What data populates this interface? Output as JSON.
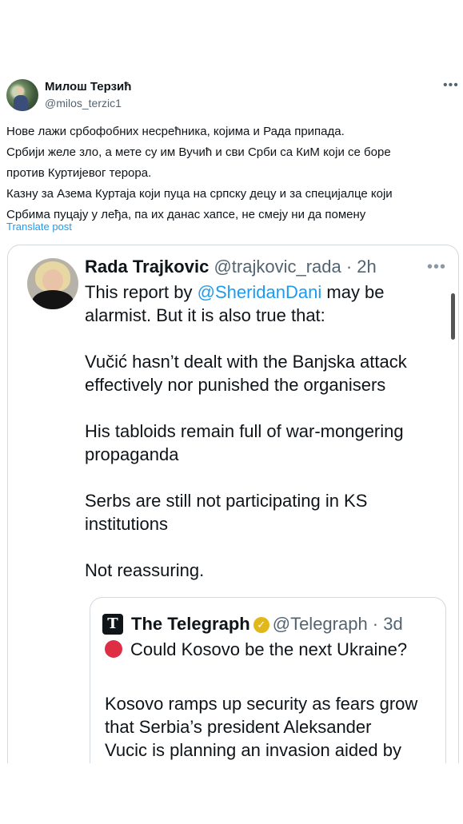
{
  "author": {
    "name": "Милош Терзић",
    "handle": "@milos_terzic1"
  },
  "more_icon": "more-horizontal-icon",
  "post_lines": [
    "Нове лажи србофобних несрећника, којима и Рада припада.",
    "Србији желе зло, а мете су им Вучић и сви Срби са КиМ који се боре",
    "против Куртијевог терора.",
    "Казну за Азема Куртаја који пуца на српску децу и за специјалце који",
    "Србима пуцају у леђа, па их данас хапсе, не смеју ни да помену"
  ],
  "translate_label": "Translate post",
  "embedded": {
    "name": "Rada Trajkovic",
    "handle_time": "@trajkovic_rada · 2h",
    "line1_pre": "This report by ",
    "mention": "@SheridanDani",
    "line1_post": " may be",
    "line2": "alarmist. But it is also true that:",
    "para2": [
      "Vučić hasn’t dealt with the Banjska attack",
      "effectively nor punished the organisers"
    ],
    "para3": [
      "His tabloids remain full of war-mongering",
      "propaganda"
    ],
    "para4": [
      "Serbs are still not participating in KS",
      "institutions"
    ],
    "para5": "Not reassuring."
  },
  "quote": {
    "logo_letter": "T",
    "name": "The Telegraph",
    "handle_time": "@Telegraph · 3d",
    "title": "Could Kosovo be the next Ukraine?",
    "body": [
      "Kosovo ramps up security as fears grow",
      "that Serbia’s president Aleksander",
      "Vucic is planning an invasion aided by"
    ]
  },
  "colors": {
    "link": "#1d9bf0",
    "secondary_text": "#536471",
    "verified_gold": "#e2b719",
    "red_circle": "#dd2e44"
  }
}
